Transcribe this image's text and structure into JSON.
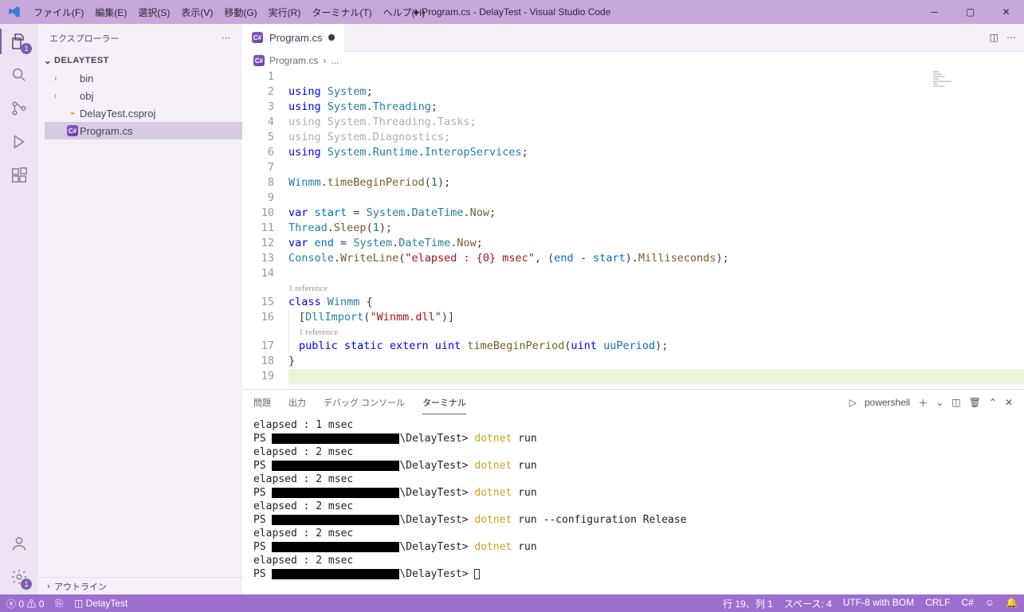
{
  "title": "● Program.cs - DelayTest - Visual Studio Code",
  "menus": [
    "ファイル(F)",
    "編集(E)",
    "選択(S)",
    "表示(V)",
    "移動(G)",
    "実行(R)",
    "ターミナル(T)",
    "ヘルプ(H)"
  ],
  "sidebar": {
    "title": "エクスプローラー",
    "project": "DELAYTEST",
    "items": [
      {
        "kind": "folder",
        "label": "bin"
      },
      {
        "kind": "folder",
        "label": "obj"
      },
      {
        "kind": "csproj",
        "label": "DelayTest.csproj"
      },
      {
        "kind": "cs",
        "label": "Program.cs",
        "selected": true
      }
    ],
    "outline": "アウトライン"
  },
  "tab": {
    "label": "Program.cs",
    "dirty": true
  },
  "crumbs": {
    "file": "Program.cs",
    "sep": "›",
    "rest": "..."
  },
  "lines": [
    {
      "n": 1,
      "t": ""
    },
    {
      "n": 2,
      "t": "using System;"
    },
    {
      "n": 3,
      "t": "using System.Threading;"
    },
    {
      "n": 4,
      "t": "using System.Threading.Tasks;",
      "dim": true
    },
    {
      "n": 5,
      "t": "using System.Diagnostics;",
      "dim": true
    },
    {
      "n": 6,
      "t": "using System.Runtime.InteropServices;"
    },
    {
      "n": 7,
      "t": ""
    },
    {
      "n": 8,
      "t": "Winmm.timeBeginPeriod(1);"
    },
    {
      "n": 9,
      "t": ""
    },
    {
      "n": 10,
      "t": "var start = System.DateTime.Now;"
    },
    {
      "n": 11,
      "t": "Thread.Sleep(1);"
    },
    {
      "n": 12,
      "t": "var end = System.DateTime.Now;"
    },
    {
      "n": 13,
      "t": "Console.WriteLine(\"elapsed : {0} msec\", (end - start).Milliseconds);"
    },
    {
      "n": 14,
      "t": ""
    },
    {
      "n": 0,
      "t": "1 reference",
      "lens": true
    },
    {
      "n": 15,
      "t": "class Winmm {"
    },
    {
      "n": 16,
      "t": "    [DllImport(\"Winmm.dll\")]"
    },
    {
      "n": 0,
      "t": "    1 reference",
      "lens": true
    },
    {
      "n": 17,
      "t": "    public static extern uint timeBeginPeriod(uint uuPeriod);"
    },
    {
      "n": 18,
      "t": "}"
    },
    {
      "n": 19,
      "t": "",
      "hl": true
    }
  ],
  "panelTabs": {
    "problems": "問題",
    "output": "出力",
    "debug": "デバッグ コンソール",
    "terminal": "ターミナル"
  },
  "termShell": "powershell",
  "terminal": [
    {
      "out": "elapsed : 1 msec"
    },
    {
      "ps": true,
      "path": "\\DelayTest>",
      "cmd": "dotnet run"
    },
    {
      "out": "elapsed : 2 msec"
    },
    {
      "ps": true,
      "path": "\\DelayTest>",
      "cmd": "dotnet run"
    },
    {
      "out": "elapsed : 2 msec"
    },
    {
      "ps": true,
      "path": "\\DelayTest>",
      "cmd": "dotnet run"
    },
    {
      "out": "elapsed : 2 msec"
    },
    {
      "ps": true,
      "path": "\\DelayTest>",
      "cmd": "dotnet run --configuration Release"
    },
    {
      "out": "elapsed : 2 msec"
    },
    {
      "ps": true,
      "path": "\\DelayTest>",
      "cmd": "dotnet run"
    },
    {
      "out": "elapsed : 2 msec"
    },
    {
      "ps": true,
      "path": "\\DelayTest>",
      "cmd": "",
      "cursor": true
    }
  ],
  "status": {
    "errors": "0",
    "warnings": "0",
    "branch": "DelayTest",
    "line": "行 19、列 1",
    "spaces": "スペース: 4",
    "enc": "UTF-8 with BOM",
    "eol": "CRLF",
    "lang": "C#"
  }
}
